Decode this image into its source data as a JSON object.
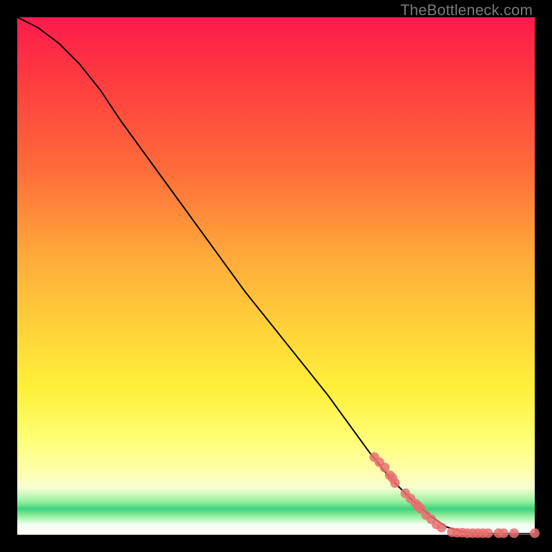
{
  "watermark": "TheBottleneck.com",
  "chart_data": {
    "type": "line",
    "title": "",
    "xlabel": "",
    "ylabel": "",
    "xlim": [
      0,
      100
    ],
    "ylim": [
      0,
      100
    ],
    "series": [
      {
        "name": "curve",
        "type": "line",
        "x": [
          0,
          4,
          8,
          12,
          16,
          20,
          28,
          36,
          44,
          52,
          60,
          68,
          72,
          76,
          80,
          83,
          86,
          88,
          92,
          96,
          100
        ],
        "y": [
          100,
          98,
          95,
          91,
          86,
          80,
          69,
          58,
          47,
          37,
          27,
          16,
          11,
          7,
          3.5,
          1.5,
          0.6,
          0.3,
          0.2,
          0.2,
          0.2
        ]
      },
      {
        "name": "points-descending",
        "type": "scatter",
        "x": [
          69,
          70,
          71,
          72,
          72.5,
          73,
          75,
          76,
          77,
          77.5,
          78,
          79,
          80,
          81,
          82
        ],
        "y": [
          15,
          14,
          13,
          11.5,
          11,
          10,
          8,
          7,
          6,
          5.5,
          5,
          3.8,
          3,
          2,
          1.4
        ]
      },
      {
        "name": "points-flat",
        "type": "scatter",
        "x": [
          84,
          85,
          86,
          87,
          88,
          89,
          90,
          91,
          93,
          94,
          96,
          100
        ],
        "y": [
          0.5,
          0.4,
          0.4,
          0.3,
          0.3,
          0.3,
          0.3,
          0.3,
          0.3,
          0.3,
          0.3,
          0.3
        ]
      }
    ],
    "colors": {
      "curve": "#000000",
      "points": "#e76f6f"
    }
  }
}
